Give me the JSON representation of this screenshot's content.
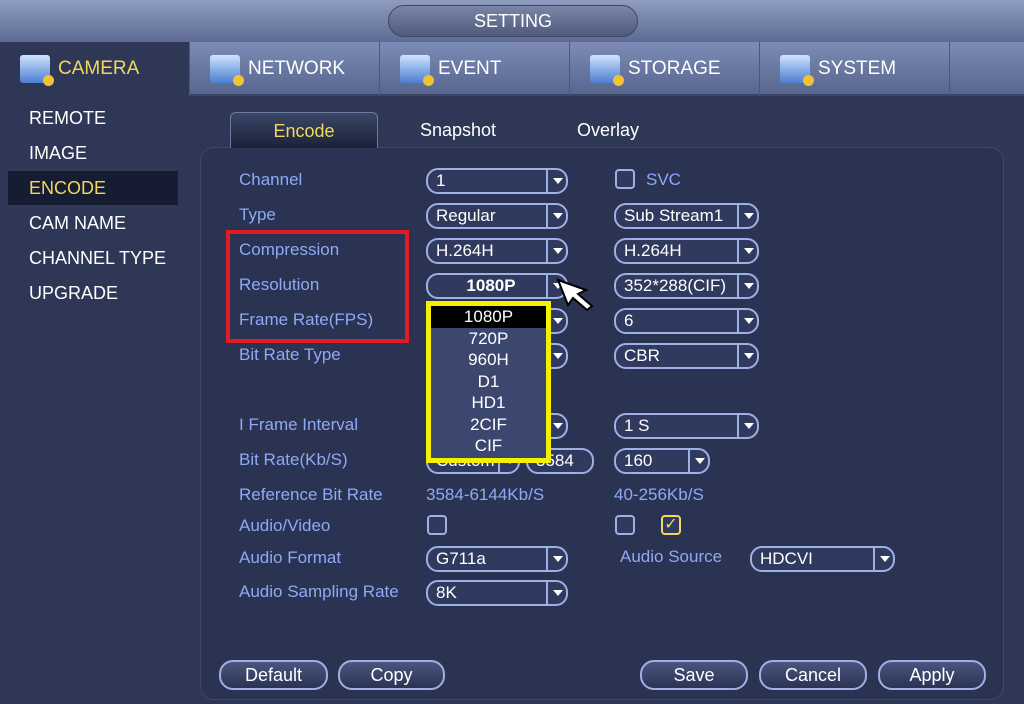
{
  "window": {
    "title": "SETTING"
  },
  "nav": [
    {
      "label": "CAMERA",
      "icon": "camera-icon"
    },
    {
      "label": "NETWORK",
      "icon": "network-icon"
    },
    {
      "label": "EVENT",
      "icon": "event-icon"
    },
    {
      "label": "STORAGE",
      "icon": "storage-icon"
    },
    {
      "label": "SYSTEM",
      "icon": "system-icon"
    }
  ],
  "sidebar": [
    "REMOTE",
    "IMAGE",
    "ENCODE",
    "CAM NAME",
    "CHANNEL TYPE",
    "UPGRADE"
  ],
  "subtabs": [
    "Encode",
    "Snapshot",
    "Overlay"
  ],
  "form": {
    "labels": {
      "channel": "Channel",
      "type": "Type",
      "compression": "Compression",
      "resolution": "Resolution",
      "fps": "Frame Rate(FPS)",
      "brt": "Bit Rate Type",
      "iframe": "I Frame Interval",
      "bitrate": "Bit Rate(Kb/S)",
      "refbr": "Reference Bit Rate",
      "av": "Audio/Video",
      "af": "Audio Format",
      "asr": "Audio Sampling Rate",
      "asrc": "Audio Source",
      "svc": "SVC"
    },
    "main": {
      "channel": "1",
      "type": "Regular",
      "compression": "H.264H",
      "resolution": "1080P",
      "bitrate_mode": "Custom",
      "bitrate": "3584",
      "refbr": "3584-6144Kb/S",
      "audio_video": false,
      "audio_format": "G711a",
      "sampling": "8K"
    },
    "sub": {
      "svc": false,
      "type": "Sub Stream1",
      "compression": "H.264H",
      "resolution": "352*288(CIF)",
      "fps": "6",
      "brt": "CBR",
      "iframe": "1 S",
      "bitrate": "160",
      "refbr": "40-256Kb/S",
      "video": false,
      "audio": true,
      "audio_source": "HDCVI"
    }
  },
  "resolution_options": [
    "1080P",
    "720P",
    "960H",
    "D1",
    "HD1",
    "2CIF",
    "CIF"
  ],
  "buttons": {
    "default": "Default",
    "copy": "Copy",
    "save": "Save",
    "cancel": "Cancel",
    "apply": "Apply"
  },
  "colors": {
    "accent": "#f2d85a",
    "highlight_box": "#e01b24",
    "popup_border": "#f5f000"
  }
}
